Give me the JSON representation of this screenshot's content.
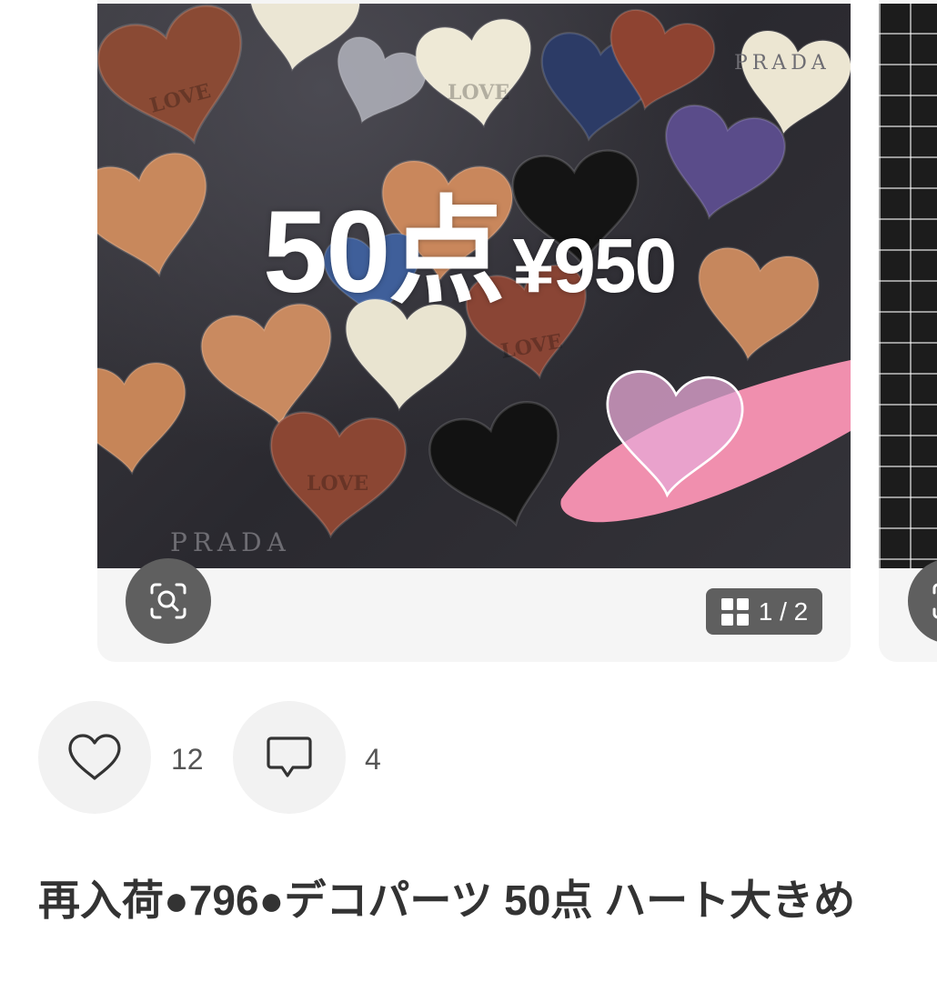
{
  "product": {
    "image_overlay": {
      "count_text": "50点",
      "price_text": "¥950"
    },
    "image_counter": "1 / 2",
    "likes": "12",
    "comments": "4",
    "title": "再入荷●796●デコパーツ 50点 ハート大きめ"
  },
  "icons": {
    "zoom": "zoom-scan-icon",
    "gallery": "grid-icon",
    "like": "heart-icon",
    "comment": "comment-icon"
  },
  "colors": {
    "button_bg": "#f2f2f2",
    "overlay_bg": "#5f5f5f",
    "title_text": "#333333",
    "count_text": "#555555"
  }
}
